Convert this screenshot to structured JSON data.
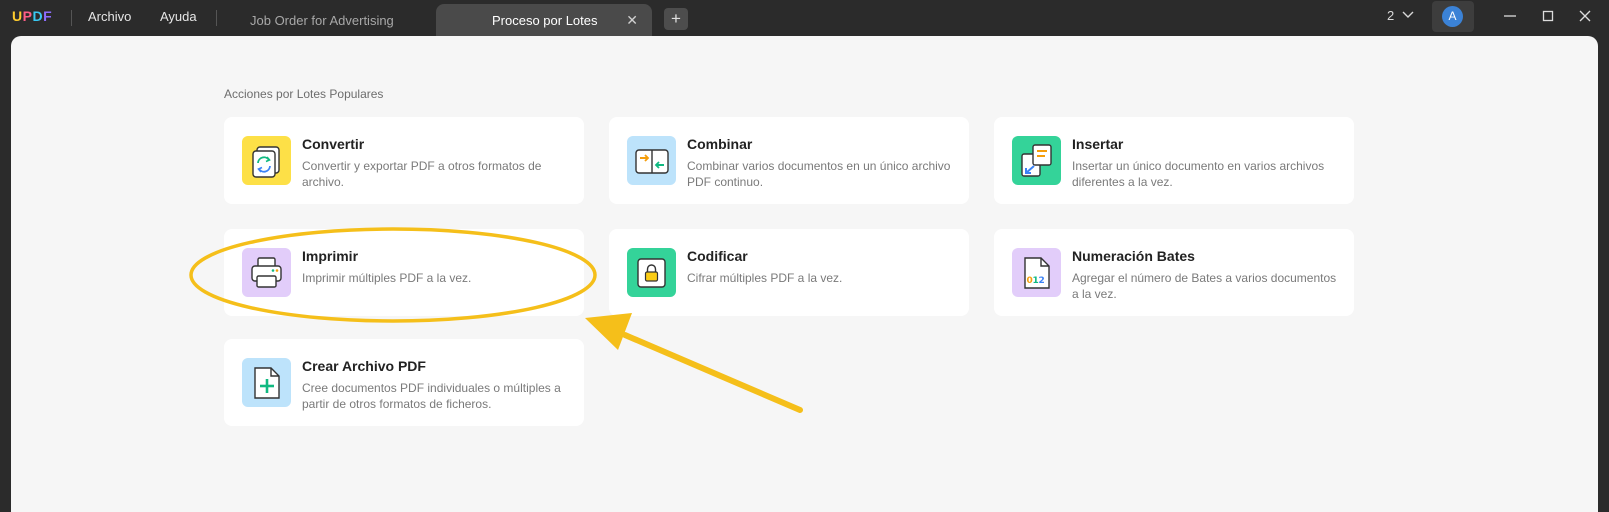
{
  "app": {
    "logo": [
      "U",
      "P",
      "D",
      "F"
    ],
    "logo_colors": [
      "#ffcc2e",
      "#ff5e86",
      "#39c8f2",
      "#8d6dff"
    ],
    "menu": {
      "file": "Archivo",
      "help": "Ayuda"
    }
  },
  "tabs": [
    {
      "label": "Job Order for Advertising",
      "active": false
    },
    {
      "label": "Proceso por Lotes",
      "active": true
    }
  ],
  "tab_add": "+",
  "tab_close": "✕",
  "titlebar": {
    "window_count": "2",
    "avatar_letter": "A"
  },
  "section": {
    "title": "Acciones por Lotes Populares"
  },
  "cards": [
    {
      "title": "Convertir",
      "desc": "Convertir y exportar PDF a otros formatos de archivo.",
      "icon": "convert-icon",
      "color": "#fde047"
    },
    {
      "title": "Combinar",
      "desc": "Combinar varios documentos en un único archivo PDF continuo.",
      "icon": "combine-icon",
      "color": "#bde3fb"
    },
    {
      "title": "Insertar",
      "desc": "Insertar un único documento en varios archivos diferentes a la vez.",
      "icon": "insert-icon",
      "color": "#34d399"
    },
    {
      "title": "Imprimir",
      "desc": "Imprimir múltiples PDF a la vez.",
      "icon": "printer-icon",
      "color": "#e2cdfa"
    },
    {
      "title": "Codificar",
      "desc": "Cifrar múltiples PDF a la vez.",
      "icon": "lock-icon",
      "color": "#34d399"
    },
    {
      "title": "Numeración Bates",
      "desc": "Agregar el número de Bates a varios documentos a la vez.",
      "icon": "bates-numbering-icon",
      "color": "#e2cdfa"
    },
    {
      "title": "Crear Archivo PDF",
      "desc": "Cree documentos PDF individuales o múltiples a partir de otros formatos de ficheros.",
      "icon": "create-pdf-icon",
      "color": "#bde3fb"
    }
  ],
  "annotation": {
    "color": "#f5bf1a",
    "type": "ellipse-and-arrow",
    "target": "Imprimir"
  }
}
